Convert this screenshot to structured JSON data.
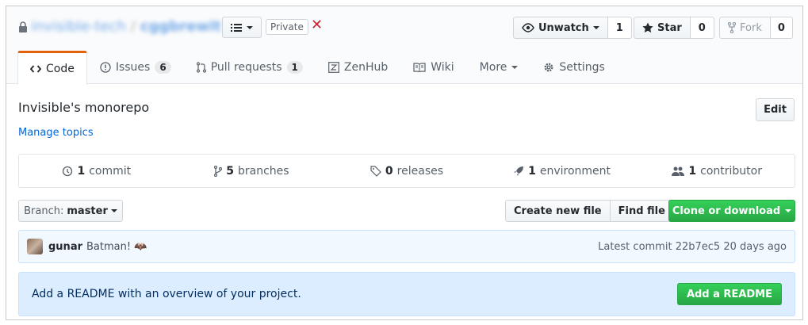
{
  "repo": {
    "owner": "invisible-tech",
    "separator": "/",
    "name": "cggbrewit",
    "visibility_badge": "Private",
    "close_symbol": "✕"
  },
  "actions": {
    "watch": {
      "label": "Unwatch",
      "count": "1"
    },
    "star": {
      "label": "Star",
      "count": "0"
    },
    "fork": {
      "label": "Fork",
      "count": "0"
    }
  },
  "tabs": [
    {
      "label": "Code",
      "icon": "code-icon",
      "counter": null
    },
    {
      "label": "Issues",
      "icon": "issue-icon",
      "counter": "6"
    },
    {
      "label": "Pull requests",
      "icon": "pull-request-icon",
      "counter": "1"
    },
    {
      "label": "ZenHub",
      "icon": "zenhub-icon",
      "counter": null
    },
    {
      "label": "Wiki",
      "icon": "book-icon",
      "counter": null
    },
    {
      "label": "More",
      "icon": "chevron-down-icon",
      "counter": null
    },
    {
      "label": "Settings",
      "icon": "gear-icon",
      "counter": null
    }
  ],
  "description": "Invisible's monorepo",
  "manage_topics": "Manage topics",
  "edit_label": "Edit",
  "summary": {
    "commits": {
      "count": "1",
      "label": "commit"
    },
    "branches": {
      "count": "5",
      "label": "branches"
    },
    "releases": {
      "count": "0",
      "label": "releases"
    },
    "environments": {
      "count": "1",
      "label": "environment"
    },
    "contributors": {
      "count": "1",
      "label": "contributor"
    }
  },
  "branch": {
    "label": "Branch:",
    "value": "master"
  },
  "file_actions": {
    "create": "Create new file",
    "find": "Find file",
    "clone": "Clone or download"
  },
  "commit": {
    "author": "gunar",
    "message": "Batman! 🦇",
    "meta_prefix": "Latest commit",
    "sha": "22b7ec5",
    "age": "20 days ago"
  },
  "readme": {
    "text": "Add a README with an overview of your project.",
    "button": "Add a README"
  },
  "colors": {
    "link": "#0366d6",
    "tab_accent": "#e36209",
    "primary_green": "#28a745",
    "danger": "#cb2431",
    "info_bg": "#dbedff"
  }
}
